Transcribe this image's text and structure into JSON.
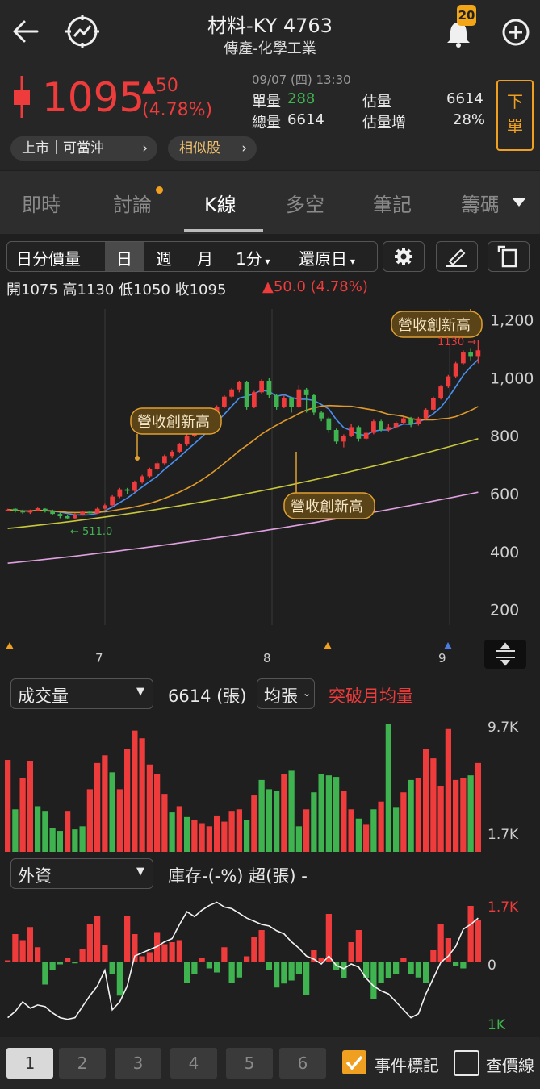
{
  "header": {
    "title": "材料-KY 4763",
    "subtitle": "傳產-化學工業",
    "notification_count": "20"
  },
  "quote": {
    "price": "1095",
    "change": "▲50",
    "change_pct": "(4.78%)",
    "datetime": "09/07 (四) 13:30",
    "single_volume_label": "單量",
    "single_volume": "288",
    "total_volume_label": "總量",
    "total_volume": "6614",
    "est_volume_label": "估量",
    "est_volume": "6614",
    "est_increase_label": "估量增",
    "est_increase": "28%",
    "market_pill": "上市｜可當沖",
    "similar_pill": "相似股",
    "order_button": "下單",
    "up_color": "#ee3b3b",
    "down_color": "#3fb34f"
  },
  "tabs": [
    "即時",
    "討論",
    "K線",
    "多空",
    "筆記",
    "籌碼"
  ],
  "active_tab": "K線",
  "toolbar": {
    "intraday": "日分價量",
    "day": "日",
    "week": "週",
    "month": "月",
    "minute": "1分",
    "restore": "還原日"
  },
  "ohlc": {
    "text": "開1075 高1130 低1050 收1095",
    "change": "▲50.0 (4.78%)"
  },
  "chart_data": [
    {
      "type": "candlestick",
      "y_ticks": [
        "1,200",
        "1,000",
        "800",
        "600",
        "400",
        "200"
      ],
      "x_ticks": [
        "7",
        "8",
        "9"
      ],
      "ylim": [
        160,
        1260
      ],
      "annotations": [
        "營收創新高",
        "營收創新高",
        "營收創新高"
      ],
      "high_label": "1130",
      "low_label": "511.0",
      "candles": [
        [
          545,
          545,
          540,
          548
        ],
        [
          548,
          540,
          535,
          550
        ],
        [
          540,
          535,
          530,
          545
        ],
        [
          535,
          542,
          530,
          545
        ],
        [
          542,
          550,
          540,
          552
        ],
        [
          548,
          540,
          535,
          550
        ],
        [
          540,
          530,
          525,
          545
        ],
        [
          530,
          522,
          515,
          535
        ],
        [
          522,
          515,
          511,
          525
        ],
        [
          515,
          528,
          512,
          532
        ],
        [
          528,
          538,
          525,
          540
        ],
        [
          538,
          532,
          528,
          542
        ],
        [
          532,
          548,
          530,
          552
        ],
        [
          548,
          560,
          545,
          565
        ],
        [
          560,
          590,
          555,
          595
        ],
        [
          590,
          615,
          585,
          620
        ],
        [
          615,
          610,
          600,
          620
        ],
        [
          610,
          640,
          605,
          645
        ],
        [
          640,
          660,
          635,
          665
        ],
        [
          660,
          685,
          655,
          690
        ],
        [
          685,
          705,
          680,
          710
        ],
        [
          705,
          730,
          700,
          735
        ],
        [
          730,
          745,
          722,
          750
        ],
        [
          745,
          770,
          740,
          775
        ],
        [
          770,
          800,
          765,
          805
        ],
        [
          800,
          820,
          795,
          825
        ],
        [
          820,
          845,
          815,
          850
        ],
        [
          845,
          870,
          840,
          875
        ],
        [
          870,
          900,
          865,
          905
        ],
        [
          900,
          935,
          895,
          940
        ],
        [
          935,
          960,
          930,
          965
        ],
        [
          960,
          985,
          950,
          990
        ],
        [
          985,
          900,
          890,
          990
        ],
        [
          900,
          950,
          895,
          955
        ],
        [
          950,
          990,
          945,
          995
        ],
        [
          990,
          940,
          930,
          1000
        ],
        [
          940,
          900,
          890,
          945
        ],
        [
          900,
          930,
          895,
          940
        ],
        [
          930,
          900,
          880,
          935
        ],
        [
          900,
          960,
          895,
          975
        ],
        [
          960,
          940,
          880,
          965
        ],
        [
          940,
          880,
          870,
          945
        ],
        [
          880,
          860,
          850,
          885
        ],
        [
          860,
          820,
          810,
          865
        ],
        [
          820,
          780,
          770,
          825
        ],
        [
          780,
          800,
          760,
          805
        ],
        [
          800,
          830,
          795,
          840
        ],
        [
          830,
          790,
          780,
          835
        ],
        [
          790,
          810,
          785,
          815
        ],
        [
          810,
          850,
          805,
          855
        ],
        [
          850,
          820,
          815,
          855
        ],
        [
          820,
          830,
          815,
          840
        ],
        [
          830,
          845,
          825,
          850
        ],
        [
          845,
          860,
          840,
          865
        ],
        [
          860,
          840,
          830,
          865
        ],
        [
          840,
          860,
          835,
          865
        ],
        [
          860,
          890,
          855,
          895
        ],
        [
          890,
          930,
          885,
          935
        ],
        [
          930,
          970,
          925,
          975
        ],
        [
          970,
          1005,
          965,
          1010
        ],
        [
          1005,
          1050,
          1000,
          1055
        ],
        [
          1050,
          1090,
          1045,
          1095
        ],
        [
          1090,
          1075,
          1060,
          1100
        ],
        [
          1075,
          1095,
          1050,
          1130
        ]
      ]
    },
    {
      "type": "bar",
      "name": "成交量",
      "y_ticks": [
        "9.7K",
        "1.7K"
      ],
      "ylim": [
        1700,
        9700
      ],
      "values": [
        7400,
        4200,
        6200,
        7300,
        4400,
        4100,
        3000,
        2800,
        4100,
        2900,
        3100,
        5500,
        7200,
        7700,
        6600,
        5500,
        8100,
        9300,
        8800,
        7100,
        6500,
        5200,
        4000,
        4400,
        3700,
        3500,
        3300,
        3100,
        3800,
        3400,
        4100,
        4200,
        3500,
        5100,
        6100,
        5500,
        5400,
        6500,
        6700,
        3100,
        4200,
        5300,
        6500,
        6400,
        6300,
        5400,
        4200,
        3600,
        3200,
        4200,
        4700,
        9700,
        4300,
        5300,
        6100,
        6200,
        8100,
        7500,
        5700,
        9400,
        6100,
        6200,
        6400,
        7200
      ],
      "up": [
        1,
        0,
        1,
        1,
        0,
        0,
        0,
        0,
        1,
        0,
        0,
        1,
        1,
        1,
        0,
        1,
        1,
        1,
        1,
        1,
        1,
        1,
        0,
        1,
        0,
        1,
        1,
        1,
        1,
        1,
        1,
        1,
        0,
        1,
        0,
        0,
        0,
        1,
        0,
        0,
        1,
        0,
        0,
        0,
        0,
        1,
        1,
        0,
        1,
        0,
        1,
        0,
        0,
        1,
        0,
        1,
        1,
        1,
        1,
        1,
        1,
        1,
        0,
        1
      ]
    },
    {
      "type": "bar",
      "name": "外資",
      "y_ticks": [
        "1.7K",
        "0",
        "1K"
      ],
      "values": [
        20,
        280,
        220,
        350,
        150,
        -220,
        -80,
        -20,
        40,
        -10,
        130,
        380,
        460,
        170,
        -120,
        -330,
        460,
        280,
        60,
        100,
        300,
        180,
        200,
        220,
        -200,
        -120,
        40,
        -60,
        -100,
        150,
        -200,
        -150,
        60,
        250,
        320,
        -80,
        -250,
        -210,
        -180,
        -120,
        -320,
        120,
        40,
        480,
        -80,
        -160,
        200,
        320,
        -160,
        -360,
        -200,
        -160,
        -120,
        40,
        -120,
        -150,
        -200,
        120,
        380,
        240,
        -40,
        -60,
        560,
        420
      ],
      "line": [
        -700,
        -620,
        -500,
        -580,
        -540,
        -560,
        -640,
        -700,
        -720,
        -700,
        -560,
        -420,
        -300,
        -100,
        -600,
        -500,
        -300,
        80,
        120,
        160,
        200,
        260,
        300,
        480,
        640,
        580,
        660,
        720,
        760,
        700,
        680,
        620,
        560,
        520,
        480,
        460,
        400,
        360,
        260,
        180,
        80,
        40,
        -20,
        80,
        -40,
        -80,
        -20,
        -60,
        -200,
        -300,
        -360,
        -400,
        -500,
        -600,
        -700,
        -650,
        -400,
        -200,
        0,
        80,
        200,
        420,
        480,
        560
      ]
    }
  ],
  "volume": {
    "selector": "成交量",
    "value": "6614 (張)",
    "avg_selector": "均張",
    "signal": "突破月均量"
  },
  "foreign": {
    "selector": "外資",
    "inventory": "庫存-(-%) 超(張) -"
  },
  "bottom": {
    "pages": [
      "1",
      "2",
      "3",
      "4",
      "5",
      "6"
    ],
    "event_mark_label": "事件標記",
    "event_mark_checked": true,
    "price_line_label": "查價線",
    "price_line_checked": false,
    "accent_color": "#f0a020"
  }
}
